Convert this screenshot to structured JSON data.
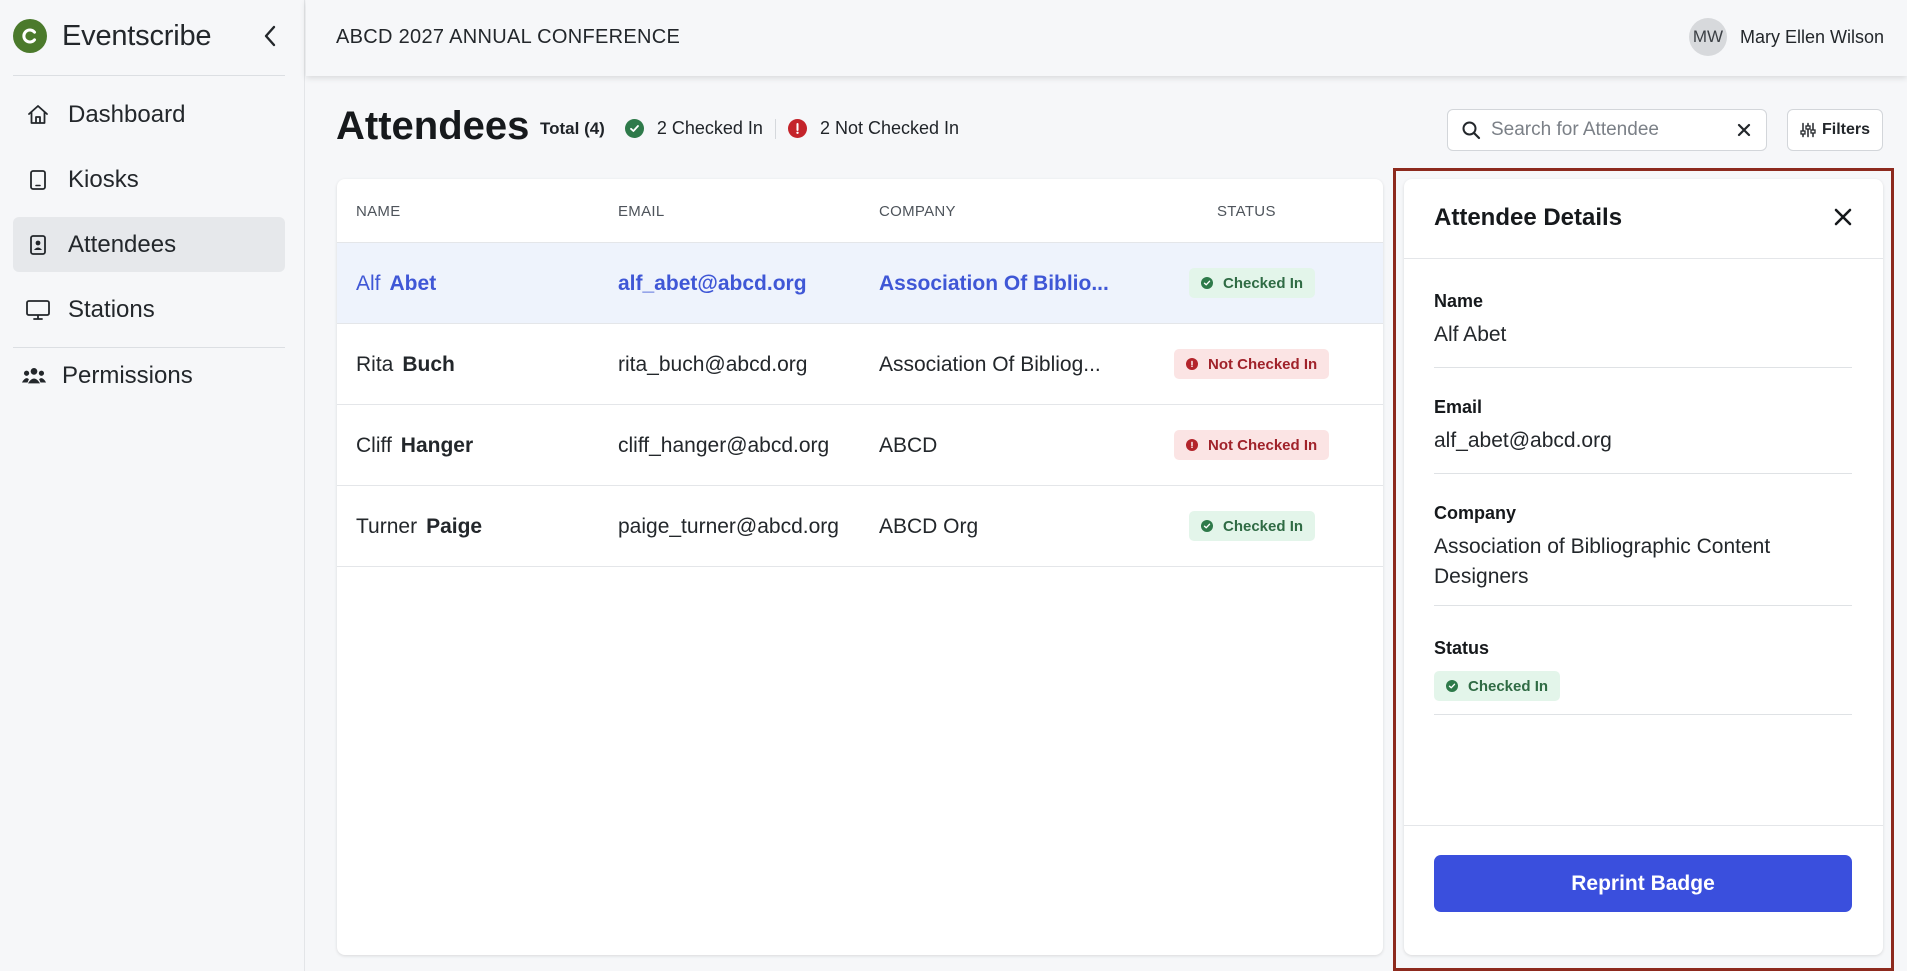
{
  "brand": {
    "name": "Eventscribe"
  },
  "sidebar": {
    "items": [
      {
        "label": "Dashboard",
        "icon": "home-icon"
      },
      {
        "label": "Kiosks",
        "icon": "tablet-icon"
      },
      {
        "label": "Attendees",
        "icon": "badge-icon",
        "active": true
      },
      {
        "label": "Stations",
        "icon": "monitor-icon"
      },
      {
        "label": "Permissions",
        "icon": "users-icon"
      }
    ]
  },
  "header": {
    "event_title": "ABCD 2027 ANNUAL CONFERENCE",
    "user": {
      "initials": "MW",
      "name": "Mary Ellen Wilson"
    }
  },
  "page": {
    "title": "Attendees",
    "total": "Total (4)",
    "checked_in": "2 Checked In",
    "not_checked_in": "2 Not Checked In",
    "search_placeholder": "Search for Attendee",
    "filters_label": "Filters"
  },
  "table": {
    "columns": [
      "NAME",
      "EMAIL",
      "COMPANY",
      "STATUS"
    ],
    "rows": [
      {
        "first": "Alf",
        "last": "Abet",
        "email": "alf_abet@abcd.org",
        "company": "Association Of Biblio...",
        "status": "Checked In",
        "status_kind": "in",
        "selected": true
      },
      {
        "first": "Rita",
        "last": "Buch",
        "email": "rita_buch@abcd.org",
        "company": "Association Of Bibliog...",
        "status": "Not Checked In",
        "status_kind": "out"
      },
      {
        "first": "Cliff",
        "last": "Hanger",
        "email": "cliff_hanger@abcd.org",
        "company": "ABCD",
        "status": "Not Checked In",
        "status_kind": "out"
      },
      {
        "first": "Turner",
        "last": "Paige",
        "email": "paige_turner@abcd.org",
        "company": "ABCD Org",
        "status": "Checked In",
        "status_kind": "in"
      }
    ]
  },
  "details": {
    "title": "Attendee Details",
    "name_label": "Name",
    "name_value": "Alf Abet",
    "email_label": "Email",
    "email_value": "alf_abet@abcd.org",
    "company_label": "Company",
    "company_value": "Association of Bibliographic Content Designers",
    "status_label": "Status",
    "status_value": "Checked In",
    "reprint_label": "Reprint Badge"
  },
  "colors": {
    "brand_green": "#4b7a2c",
    "accent_blue": "#3a4fdd",
    "selected_row": "#eef3fc",
    "checked_in_green": "#2e7a4a",
    "not_checked_in_red": "#b3242b",
    "highlight_border": "#8d2a1e"
  }
}
